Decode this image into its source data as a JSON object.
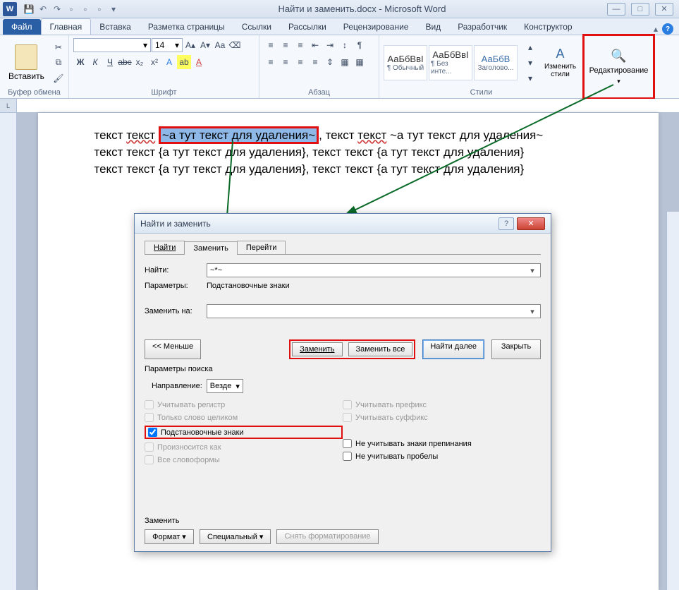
{
  "titlebar": {
    "app_title": "Найти и заменить.docx - Microsoft Word",
    "min": "—",
    "max": "□",
    "close": "✕"
  },
  "ribbon": {
    "tabs": {
      "file": "Файл",
      "home": "Главная",
      "insert": "Вставка",
      "layout": "Разметка страницы",
      "references": "Ссылки",
      "mailings": "Рассылки",
      "review": "Рецензирование",
      "view": "Вид",
      "developer": "Разработчик",
      "design": "Конструктор"
    },
    "groups": {
      "clipboard": {
        "label": "Буфер обмена",
        "paste": "Вставить"
      },
      "font": {
        "label": "Шрифт",
        "size": "14"
      },
      "paragraph": {
        "label": "Абзац"
      },
      "styles": {
        "label": "Стили",
        "items": [
          "АаБбВвІ",
          "АаБбВвІ",
          "АаБбВ"
        ],
        "names": [
          "¶ Обычный",
          "¶ Без инте...",
          "Заголово..."
        ],
        "change": "Изменить стили"
      },
      "editing": {
        "label": "Редактирование"
      }
    }
  },
  "document": {
    "line1_a": "текст ",
    "line1_wavy": "текст",
    "line1_sel": "~а тут текст для удаления~",
    "line1_b": ", текст ",
    "line1_c": " ~а тут текст для удаления~",
    "line2": "текст текст {а тут текст для удаления}, текст текст {а тут текст для удаления}",
    "line3": "текст текст {а тут текст для удаления}, текст текст {а тут текст для удаления}"
  },
  "dialog": {
    "title": "Найти и заменить",
    "tabs": {
      "find": "Найти",
      "replace": "Заменить",
      "goto": "Перейти"
    },
    "find_label": "Найти:",
    "find_value": "~*~",
    "params_label": "Параметры:",
    "params_value": "Подстановочные знаки",
    "replace_label": "Заменить на:",
    "replace_value": "",
    "btn_less": "<< Меньше",
    "btn_replace": "Заменить",
    "btn_replace_all": "Заменить все",
    "btn_find_next": "Найти далее",
    "btn_close": "Закрыть",
    "search_params": "Параметры поиска",
    "direction_label": "Направление:",
    "direction_value": "Везде",
    "checks": {
      "case": "Учитывать регистр",
      "whole": "Только слово целиком",
      "wildcards": "Подстановочные знаки",
      "sounds": "Произносится как",
      "forms": "Все словоформы",
      "prefix": "Учитывать префикс",
      "suffix": "Учитывать суффикс",
      "punct": "Не учитывать знаки препинания",
      "spaces": "Не учитывать пробелы"
    },
    "footer_label": "Заменить",
    "btn_format": "Формат",
    "btn_special": "Специальный",
    "btn_noformat": "Снять форматирование"
  }
}
